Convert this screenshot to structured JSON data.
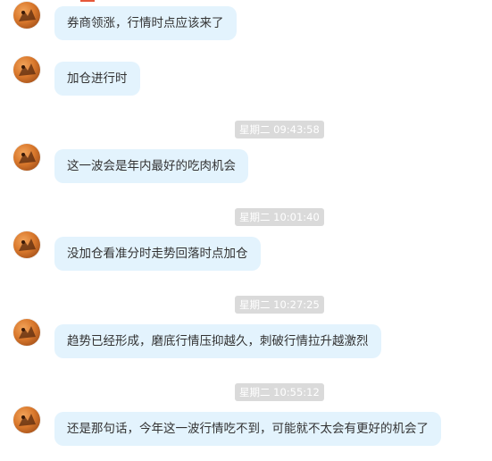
{
  "chat": {
    "messages": [
      {
        "text": "券商领涨，行情时点应该来了"
      },
      {
        "text": "加仓进行时"
      },
      {
        "timestamp": "星期二 09:43:58",
        "text": "这一波会是年内最好的吃肉机会"
      },
      {
        "timestamp": "星期二 10:01:40",
        "text": "没加仓看准分时走势回落时点加仓"
      },
      {
        "timestamp": "星期二 10:27:25",
        "text": "趋势已经形成，磨底行情压抑越久，刺破行情拉升越激烈"
      },
      {
        "timestamp": "星期二 10:55:12",
        "text": "还是那句话，今年这一波行情吃不到，可能就不太会有更好的机会了"
      }
    ]
  },
  "colors": {
    "bubble_bg": "#e3f3fd",
    "timestamp_bg": "#dadada",
    "accent": "#e6583a"
  },
  "icons": {
    "avatar": "orange-animal-avatar"
  }
}
